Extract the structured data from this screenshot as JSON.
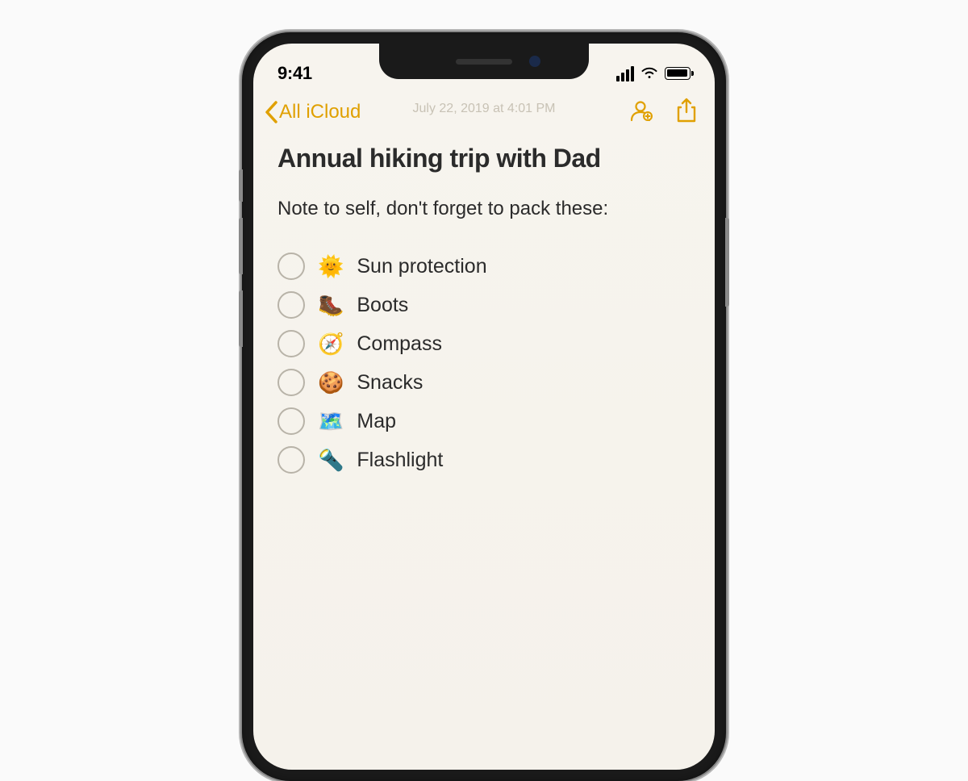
{
  "status": {
    "time": "9:41"
  },
  "nav": {
    "back_label": "All iCloud",
    "timestamp": "July 22, 2019 at 4:01 PM"
  },
  "note": {
    "title": "Annual hiking trip with Dad",
    "subtitle": "Note to self, don't forget to pack these:"
  },
  "checklist": [
    {
      "emoji": "🌞",
      "label": "Sun protection"
    },
    {
      "emoji": "🥾",
      "label": "Boots"
    },
    {
      "emoji": "🧭",
      "label": "Compass"
    },
    {
      "emoji": "🍪",
      "label": "Snacks"
    },
    {
      "emoji": "🗺️",
      "label": "Map"
    },
    {
      "emoji": "🔦",
      "label": "Flashlight"
    }
  ]
}
